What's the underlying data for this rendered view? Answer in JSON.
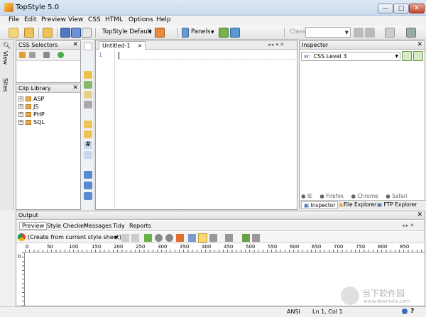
{
  "window": {
    "title": "TopStyle 5.0"
  },
  "menu": [
    "File",
    "Edit",
    "Preview",
    "View",
    "CSS",
    "HTML",
    "Options",
    "Help"
  ],
  "toolbar": {
    "style_combo": "TopStyle Default",
    "panels_label": "Panels",
    "class_label": "Class",
    "class_value": ""
  },
  "left_tabs": [
    "View",
    "Sites"
  ],
  "css_selectors": {
    "title": "CSS Selectors"
  },
  "clip_library": {
    "title": "Clip Library",
    "items": [
      "ASP",
      "JS",
      "PHP",
      "SQL"
    ]
  },
  "editor": {
    "tab": "Untitled-1",
    "line": "1"
  },
  "inspector": {
    "title": "Inspector",
    "level": "CSS Level 3",
    "browsers": [
      "IE",
      "Firefox",
      "Chrome",
      "Safari"
    ],
    "tabs": [
      "Inspector",
      "File Explorer",
      "FTP Explorer"
    ]
  },
  "output": {
    "title": "Output",
    "tabs": [
      "Preview",
      "Style Checker",
      "Messages",
      "Tidy",
      "Reports"
    ],
    "source_combo": "(Create from current style sheet)",
    "ruler": [
      "0",
      "50",
      "100",
      "150",
      "200",
      "250",
      "300",
      "350",
      "400",
      "450",
      "500",
      "550",
      "600",
      "650",
      "700",
      "750",
      "800",
      "850"
    ]
  },
  "status": {
    "encoding": "ANSI",
    "position": "Ln 1, Col 1"
  },
  "watermark": {
    "cn": "当下软件园",
    "url": "www.downxia.com"
  }
}
